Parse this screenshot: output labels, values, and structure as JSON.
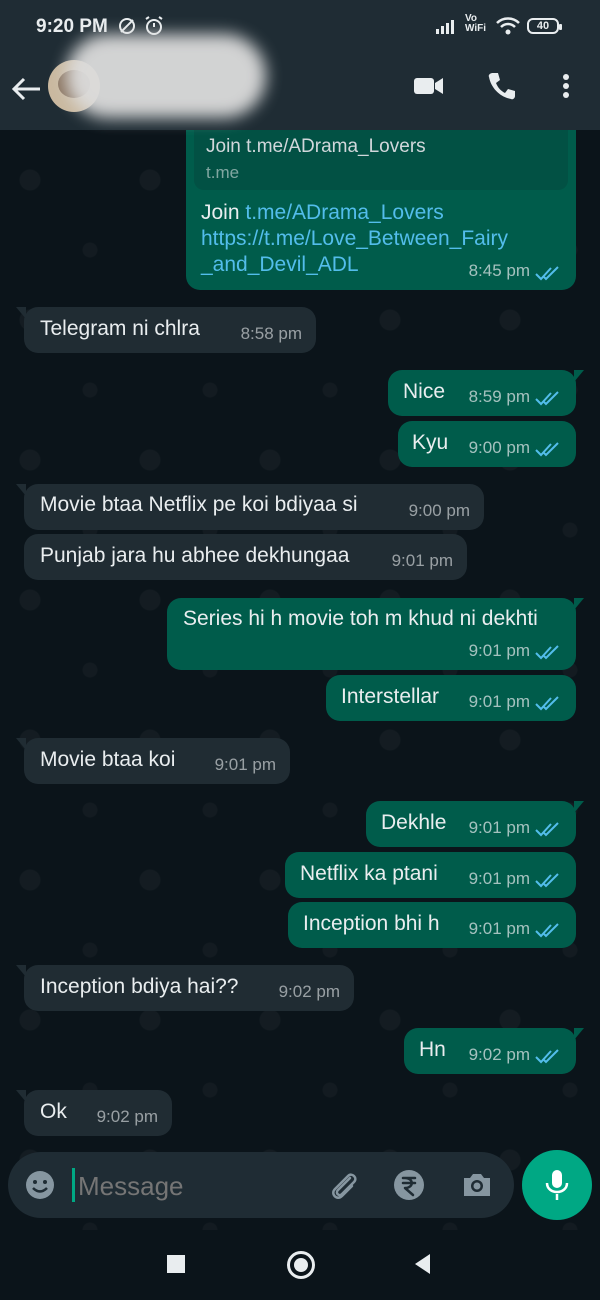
{
  "status_bar": {
    "time": "9:20 PM",
    "network_label": "Vo\nWiFi",
    "battery": "40"
  },
  "header": {
    "contact_name": "",
    "icons": [
      "back-arrow-icon",
      "video-call-icon",
      "voice-call-icon",
      "more-options-icon"
    ]
  },
  "link_preview": {
    "title": "Join t.me/ADrama_Lovers",
    "domain": "t.me"
  },
  "messages": [
    {
      "dir": "out",
      "text_prefix": "Join ",
      "link1": "t.me/ADrama_Lovers",
      "link2": "https://t.me/Love_Between_Fairy",
      "link3": "_and_Devil_ADL",
      "time": "8:45 pm"
    },
    {
      "dir": "in",
      "text": "Telegram ni chlra",
      "time": "8:58 pm"
    },
    {
      "dir": "out",
      "text": "Nice",
      "time": "8:59 pm"
    },
    {
      "dir": "out",
      "text": "Kyu",
      "time": "9:00 pm"
    },
    {
      "dir": "in",
      "text": "Movie btaa Netflix pe koi bdiyaa si",
      "time": "9:00 pm"
    },
    {
      "dir": "in",
      "text": "Punjab jara hu abhee dekhungaa",
      "time": "9:01 pm"
    },
    {
      "dir": "out",
      "text": "Series hi h movie toh m khud ni dekhti",
      "time": "9:01 pm"
    },
    {
      "dir": "out",
      "text": "Interstellar",
      "time": "9:01 pm"
    },
    {
      "dir": "in",
      "text": "Movie btaa koi",
      "time": "9:01 pm"
    },
    {
      "dir": "out",
      "text": "Dekhle",
      "time": "9:01 pm"
    },
    {
      "dir": "out",
      "text": "Netflix ka ptani",
      "time": "9:01 pm"
    },
    {
      "dir": "out",
      "text": "Inception bhi h",
      "time": "9:01 pm"
    },
    {
      "dir": "in",
      "text": "Inception bdiya hai??",
      "time": "9:02 pm"
    },
    {
      "dir": "out",
      "text": "Hn",
      "time": "9:02 pm"
    },
    {
      "dir": "in",
      "text": "Ok",
      "time": "9:02 pm"
    }
  ],
  "composer": {
    "placeholder": "Message",
    "icons": [
      "emoji-icon",
      "attach-icon",
      "rupee-payment-icon",
      "camera-icon",
      "mic-icon"
    ]
  },
  "colors": {
    "header_bg": "#1f2c34",
    "chat_bg": "#0b141a",
    "incoming_bubble": "#202c33",
    "outgoing_bubble": "#005c4b",
    "read_ticks": "#53bdeb",
    "accent": "#00a884"
  }
}
